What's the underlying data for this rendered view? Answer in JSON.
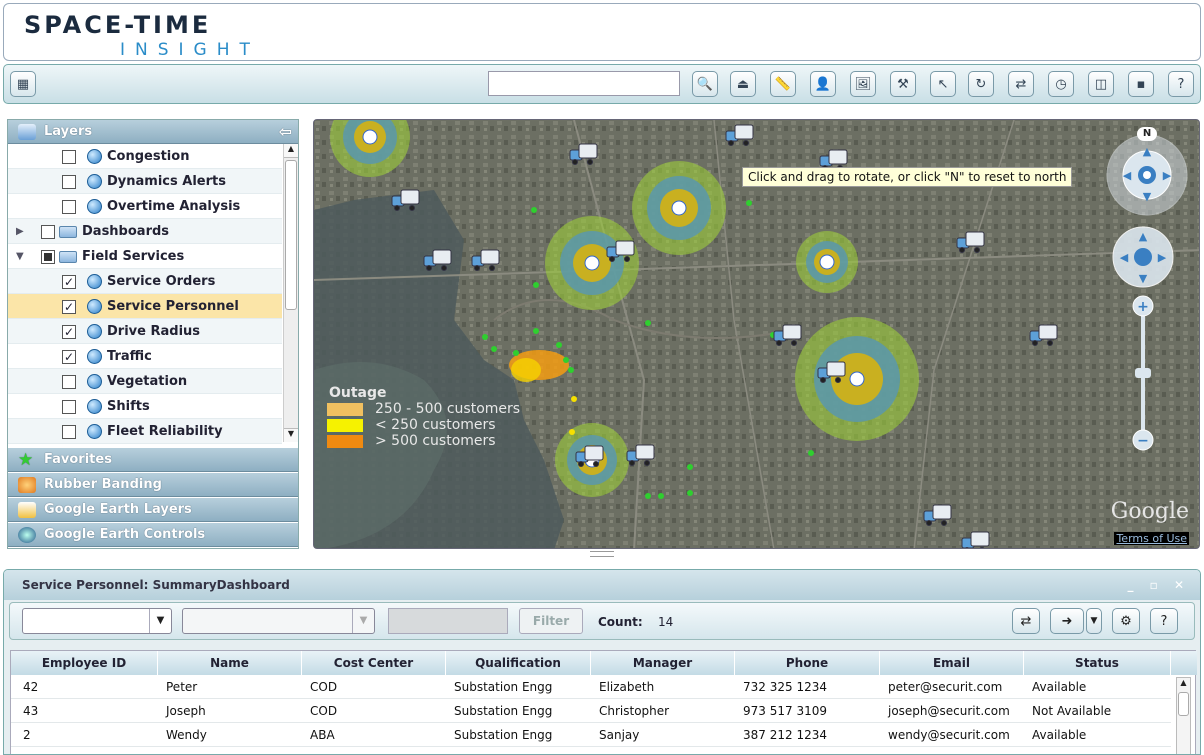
{
  "app": {
    "logo_line1": "SPACE-TIME",
    "logo_line2": "INSIGHT"
  },
  "toolbar": {
    "search_value": "",
    "icons": [
      "table-icon",
      "zoom-icon",
      "eject-icon",
      "ruler-icon",
      "person-icon",
      "photo-icon",
      "tools-icon",
      "pointer-icon",
      "refresh-icon",
      "sync-icon",
      "clock-icon",
      "panel-icon",
      "window-icon",
      "help-icon"
    ]
  },
  "panels": {
    "layers": "Layers",
    "favorites": "Favorites",
    "rubber": "Rubber Banding",
    "ge_layers": "Google Earth Layers",
    "ge_controls": "Google Earth Controls"
  },
  "tree": [
    {
      "label": "Congestion",
      "checked": false
    },
    {
      "label": "Dynamics Alerts",
      "checked": false
    },
    {
      "label": "Overtime Analysis",
      "checked": false
    },
    {
      "label": "Dashboards",
      "checked": false
    },
    {
      "label": "Field Services",
      "checked": "partial"
    },
    {
      "label": "Service Orders",
      "checked": true
    },
    {
      "label": "Service Personnel",
      "checked": true,
      "selected": true
    },
    {
      "label": "Drive Radius",
      "checked": true
    },
    {
      "label": "Traffic",
      "checked": true
    },
    {
      "label": "Vegetation",
      "checked": false
    },
    {
      "label": "Shifts",
      "checked": false
    },
    {
      "label": "Fleet Reliability",
      "checked": false
    }
  ],
  "map": {
    "tooltip": "Click and drag to rotate, or click \"N\" to reset to north",
    "north": "N",
    "legend": {
      "title": "Outage",
      "items": [
        {
          "label": "250 - 500 customers",
          "color": "#f0c060"
        },
        {
          "label": "< 250 customers",
          "color": "#f6f200"
        },
        {
          "label": "> 500 customers",
          "color": "#f08a10"
        }
      ]
    },
    "google": "Google",
    "terms": "Terms of Use"
  },
  "dashboard": {
    "title": "Service Personnel: SummaryDashboard",
    "window_controls": "_ ▫ ✕",
    "filter_label": "Filter",
    "count_label": "Count:",
    "count_value": "14",
    "columns": [
      "Employee ID",
      "Name",
      "Cost Center",
      "Qualification",
      "Manager",
      "Phone",
      "Email",
      "Status"
    ],
    "rows": [
      [
        "42",
        "Peter",
        "COD",
        "Substation Engg",
        "Elizabeth",
        "732 325 1234",
        "peter@securit.com",
        "Available"
      ],
      [
        "43",
        "Joseph",
        "COD",
        "Substation Engg",
        "Christopher",
        "973 517 3109",
        "joseph@securit.com",
        "Not Available"
      ],
      [
        "2",
        "Wendy",
        "ABA",
        "Substation Engg",
        "Sanjay",
        "387 212 1234",
        "wendy@securit.com",
        "Available"
      ]
    ]
  }
}
